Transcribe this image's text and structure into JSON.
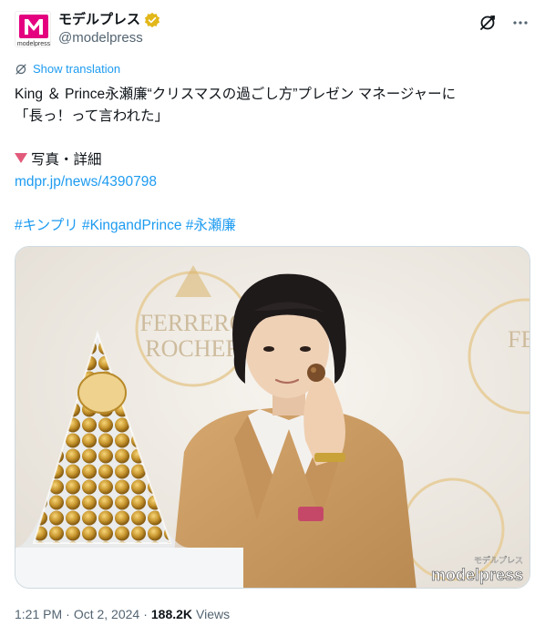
{
  "author": {
    "display_name": "モデルプレス",
    "handle": "@modelpress",
    "avatar_label": "modelpress",
    "verified_icon": "verified-badge-icon"
  },
  "actions": {
    "grok_icon": "grok-icon",
    "more_icon": "more-dots-icon"
  },
  "translation": {
    "label": "Show translation"
  },
  "tweet": {
    "line1": "King ＆ Prince永瀬廉“クリスマスの過ごし方”プレゼン マネージャーに",
    "line2": "「長っ！って言われた」",
    "detail_label": "写真・詳細",
    "link": "mdpr.jp/news/4390798",
    "hashtags": [
      "#キンプリ",
      "#KingandPrince",
      "#永瀬廉"
    ]
  },
  "media": {
    "watermark_small": "モデルプレス",
    "watermark": "modelpress",
    "backdrop_brand_1": "FERRERO",
    "backdrop_brand_2": "ROCHER"
  },
  "meta": {
    "time": "1:21 PM",
    "sep": "·",
    "date": "Oct 2, 2024",
    "views": "188.2K",
    "views_label": "Views"
  },
  "colors": {
    "accent": "#1d9bf0",
    "brand_magenta": "#e4007f",
    "verified_gold": "#e2b719"
  }
}
